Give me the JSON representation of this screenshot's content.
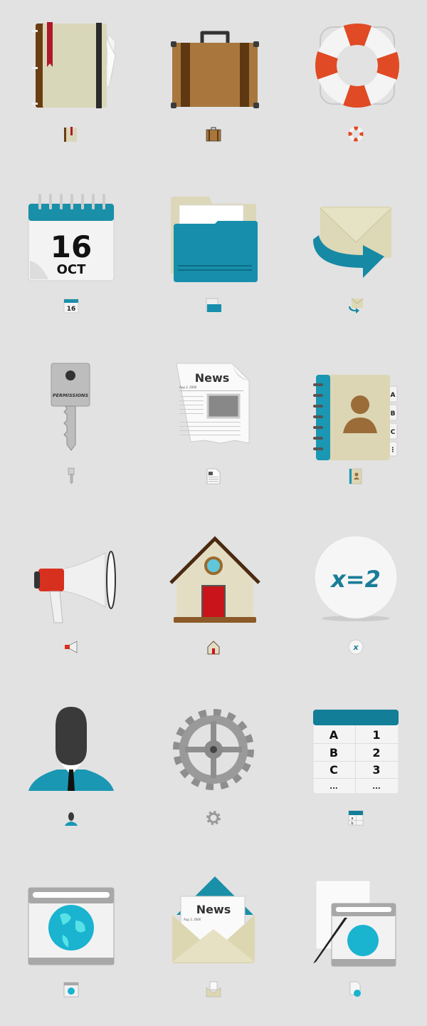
{
  "background": "#e2e2e2",
  "accent": "#1a8fa8",
  "icons": [
    {
      "name": "notebook",
      "label": ""
    },
    {
      "name": "briefcase",
      "label": ""
    },
    {
      "name": "lifebuoy",
      "label": ""
    },
    {
      "name": "calendar",
      "day": "16",
      "month": "OCT",
      "small_day": "16"
    },
    {
      "name": "folder-open",
      "label": ""
    },
    {
      "name": "mail-forward",
      "label": ""
    },
    {
      "name": "key",
      "tag_text": "PERMISSIONS"
    },
    {
      "name": "newspaper",
      "title": "News",
      "date": "Aug 3, 2006"
    },
    {
      "name": "address-book",
      "tabs": [
        "A",
        "B",
        "C",
        "⋮"
      ]
    },
    {
      "name": "megaphone",
      "label": ""
    },
    {
      "name": "home",
      "label": ""
    },
    {
      "name": "formula",
      "text": "x=2",
      "small_text": "x"
    },
    {
      "name": "user",
      "label": ""
    },
    {
      "name": "gear",
      "label": ""
    },
    {
      "name": "table",
      "col_a": [
        "A",
        "B",
        "C",
        "..."
      ],
      "col_b": [
        "1",
        "2",
        "3",
        "..."
      ],
      "small_col_a": [
        "a",
        "b"
      ]
    },
    {
      "name": "web-browser",
      "label": ""
    },
    {
      "name": "newsletter",
      "title": "News",
      "date": "Aug 3, 2006"
    },
    {
      "name": "web-edit",
      "label": ""
    }
  ]
}
